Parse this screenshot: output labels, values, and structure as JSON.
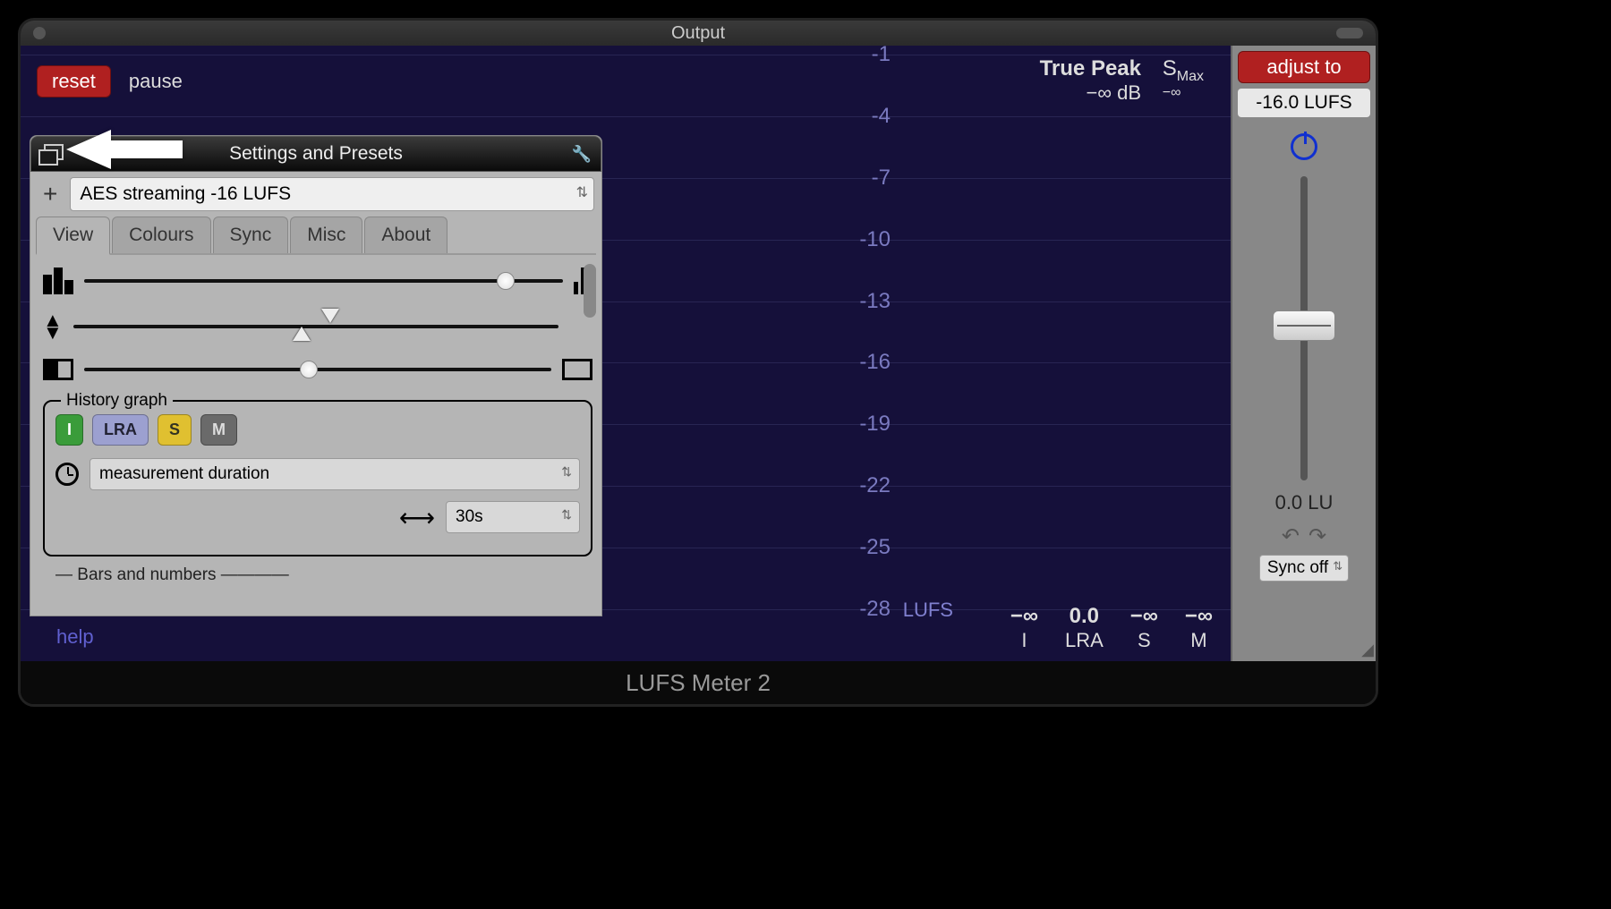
{
  "window_title": "Output",
  "app_name": "LUFS Meter 2",
  "toolbar": {
    "reset": "reset",
    "pause": "pause"
  },
  "scale_ticks": [
    "-1",
    "-4",
    "-7",
    "-10",
    "-13",
    "-16",
    "-19",
    "-22",
    "-25",
    "-28"
  ],
  "true_peak": {
    "label": "True Peak",
    "value": "−∞ dB"
  },
  "smax": {
    "label": "S",
    "sub": "Max",
    "value": "−∞"
  },
  "lufs_label": "LUFS",
  "readouts": {
    "i": {
      "value": "−∞",
      "label": "I"
    },
    "lra": {
      "value": "0.0",
      "label": "LRA"
    },
    "s": {
      "value": "−∞",
      "label": "S"
    },
    "m": {
      "value": "−∞",
      "label": "M"
    }
  },
  "help": "help",
  "panel": {
    "title": "Settings and Presets",
    "preset": "AES streaming -16 LUFS",
    "tabs": [
      "View",
      "Colours",
      "Sync",
      "Misc",
      "About"
    ],
    "history": {
      "title": "History graph",
      "buttons": {
        "i": "I",
        "lra": "LRA",
        "s": "S",
        "m": "M"
      },
      "duration_label": "measurement duration",
      "duration_value": "30s"
    },
    "bars_numbers": "Bars and numbers"
  },
  "side": {
    "adjust": "adjust to",
    "target": "-16.0 LUFS",
    "lu": "0.0 LU",
    "sync": "Sync off"
  }
}
